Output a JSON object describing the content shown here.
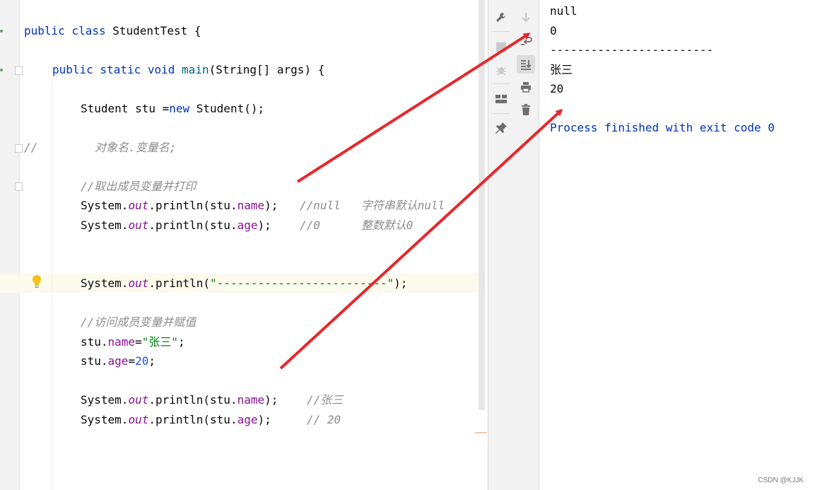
{
  "editor": {
    "lines": {
      "class_decl": {
        "kw1": "public",
        "kw2": "class",
        "name": "StudentTest",
        "brace": " {"
      },
      "main_decl": {
        "kw1": "public",
        "kw2": "static",
        "kw3": "void",
        "name": "main",
        "params": "(String[] args) {"
      },
      "new_obj": {
        "pre": "Student stu =",
        "kw": "new",
        "post": " Student();"
      },
      "comment_obj": {
        "slashes": "//",
        "text": "对象名.变量名;"
      },
      "comment_get": "//取出成员变量并打印",
      "print_name": {
        "sys": "System.",
        "out": "out",
        "call": ".println(stu.",
        "field": "name",
        "close": ");",
        "cmt": "//null   字符串默认null"
      },
      "print_age": {
        "sys": "System.",
        "out": "out",
        "call": ".println(stu.",
        "field": "age",
        "close": ");",
        "cmt": "//0      整数默认0"
      },
      "print_sep": {
        "sys": "System.",
        "out": "out",
        "call": ".println(",
        "str": "\"-------------------------\"",
        "close": ");"
      },
      "comment_set": "//访问成员变量并赋值",
      "assign_name": {
        "pre": "stu.",
        "field": "name",
        "eq": "=",
        "str": "\"张三\"",
        "end": ";"
      },
      "assign_age": {
        "pre": "stu.",
        "field": "age",
        "eq": "=",
        "num": "20",
        "end": ";"
      },
      "print_name2": {
        "sys": "System.",
        "out": "out",
        "call": ".println(stu.",
        "field": "name",
        "close": ");",
        "cmt": "//张三"
      },
      "print_age2": {
        "sys": "System.",
        "out": "out",
        "call": ".println(stu.",
        "field": "age",
        "close": ");",
        "cmt": "// 20"
      }
    }
  },
  "toolbar_left": {
    "icons": [
      "wrench-icon",
      "stop-icon",
      "debug-icon",
      "layout-icon",
      "pin-icon"
    ]
  },
  "toolbar_right": {
    "icons": [
      "arrow-down-icon",
      "soft-wrap-icon",
      "scroll-to-end-icon",
      "print-icon",
      "trash-icon"
    ]
  },
  "console": {
    "lines": [
      "null",
      "0",
      "------------------------",
      "张三",
      "20"
    ],
    "process": "Process finished with exit code 0"
  },
  "annotation": {
    "arrow_color": "#e8262a"
  },
  "watermark": "CSDN @KJJK",
  "colors": {
    "keyword": "#0033b3",
    "field": "#871094",
    "string": "#067d17",
    "number": "#1750eb",
    "comment": "#8c8c8c"
  }
}
